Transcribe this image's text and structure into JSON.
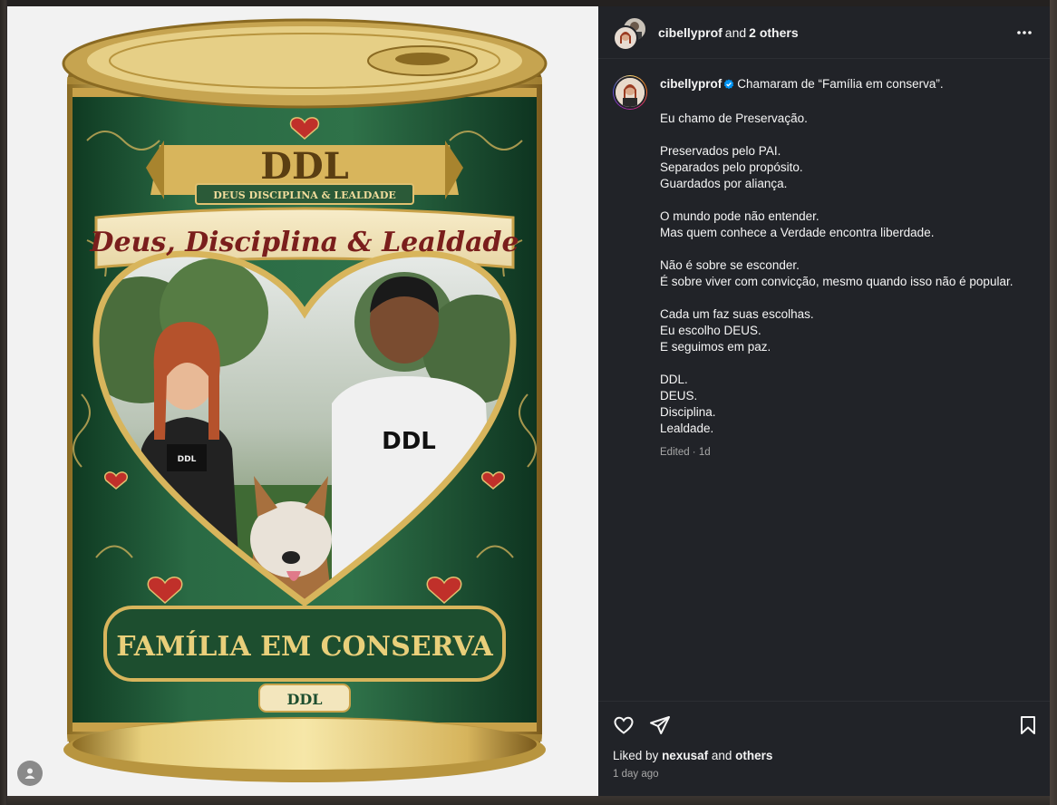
{
  "header": {
    "username": "cibellyprof",
    "and_text": "and",
    "others": "2 others"
  },
  "caption": {
    "username": "cibellyprof",
    "lines": [
      "Chamaram de “Família em conserva”.",
      "Eu chamo de Preservação.",
      "Preservados pelo PAI.",
      "Separados pelo propósito.",
      "Guardados por aliança.",
      "O mundo pode não entender.",
      "Mas quem conhece a Verdade encontra liberdade.",
      "Não é sobre se esconder.",
      "É sobre viver com convicção, mesmo quando isso não é popular.",
      "Cada um faz suas escolhas.",
      "Eu escolho DEUS.",
      "E seguimos em paz.",
      "DDL.",
      "DEUS.",
      "Disciplina.",
      "Lealdade."
    ],
    "edited": "Edited · 1d"
  },
  "likes": {
    "prefix": "Liked by",
    "user": "nexusaf",
    "and_text": "and",
    "others": "others"
  },
  "timestamp": "1 day ago",
  "image": {
    "ribbon_title": "DDL",
    "ribbon_sub": "DEUS DISCIPLINA & LEALDADE",
    "script_title": "Deus, Disciplina & Lealdade",
    "bottom_title": "FAMÍLIA EM CONSERVA",
    "bottom_sub": "DDL",
    "shirt_logo": "DDL"
  },
  "icons": {
    "more": "more-horizontal-icon",
    "verified": "verified-badge-icon",
    "like": "heart-icon",
    "share": "send-icon",
    "save": "bookmark-icon",
    "tag": "user-tag-icon"
  },
  "colors": {
    "panel": "#212328",
    "can_green": "#1f5a36",
    "gold": "#c9a24a",
    "verified_blue": "#0095f6"
  }
}
